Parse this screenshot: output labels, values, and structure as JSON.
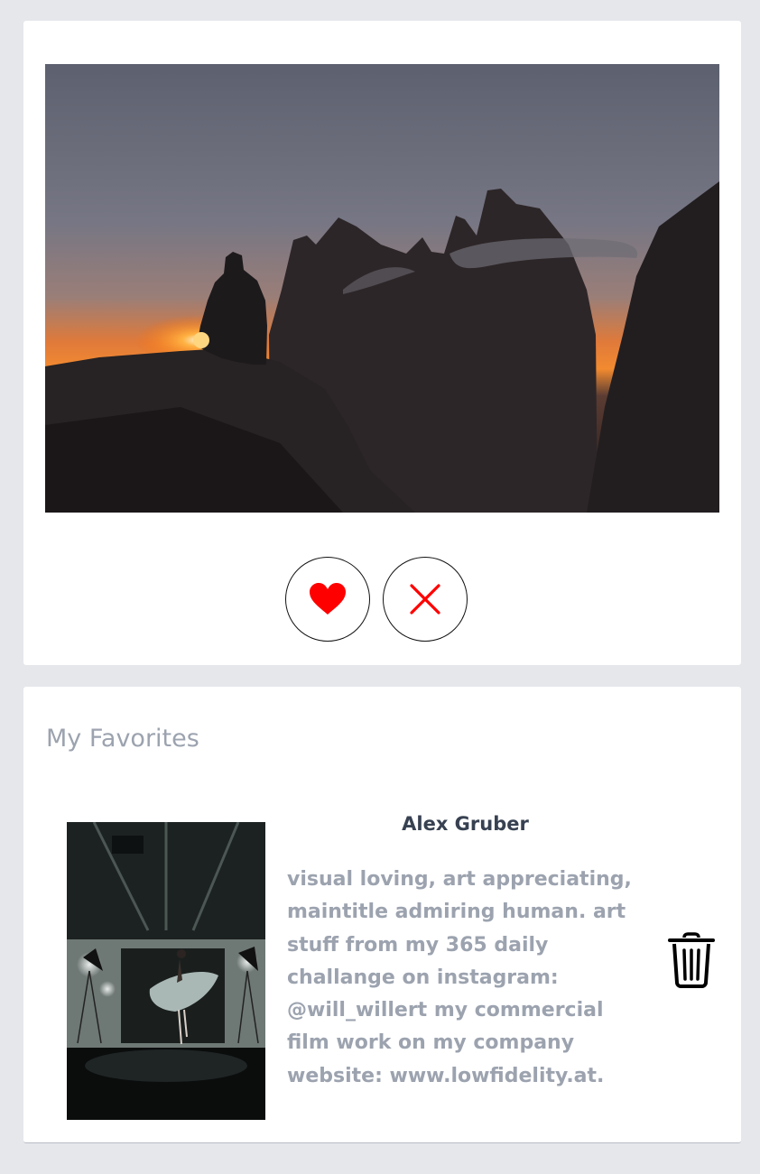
{
  "colors": {
    "page_background": "#e5e7eb",
    "card_background": "#ffffff",
    "accent_red": "#ff0000",
    "heading_gray": "#9ca3af",
    "name_text": "#374151"
  },
  "hero": {
    "image_icon": "mountain-sunset-photo"
  },
  "actions": {
    "like_icon": "heart-icon",
    "dismiss_icon": "close-icon"
  },
  "favorites": {
    "title": "My Favorites",
    "items": [
      {
        "name": "Alex Gruber",
        "description": "visual loving, art appreciating, maintitle admiring human. art stuff from my 365 daily challange on instagram: @will_willert my commercial film work on my company website: www.lowfidelity.at.",
        "thumb_icon": "dancer-studio-photo",
        "remove_icon": "trash-icon"
      }
    ]
  }
}
